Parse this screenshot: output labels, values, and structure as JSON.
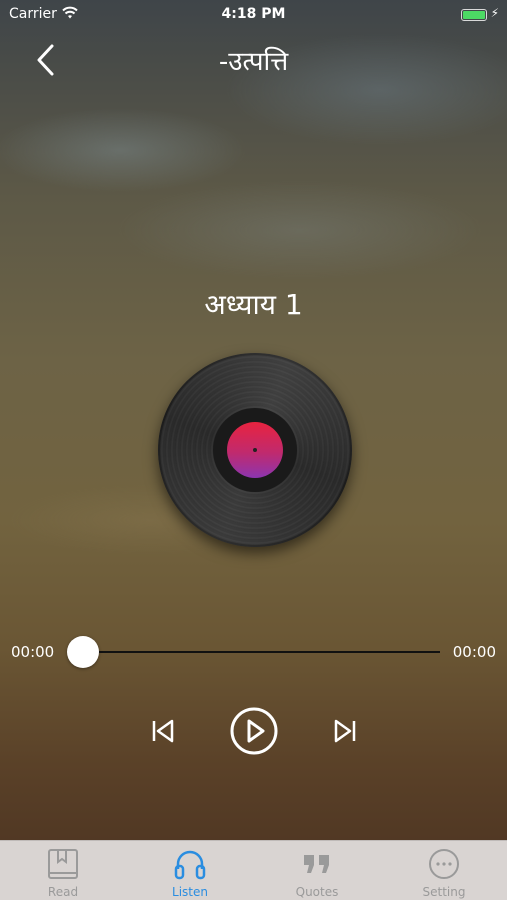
{
  "status_bar": {
    "carrier": "Carrier",
    "time": "4:18 PM"
  },
  "nav": {
    "title": "-उत्पत्ति",
    "back_icon": "chevron-left-icon"
  },
  "player": {
    "chapter": "अध्याय 1",
    "elapsed": "00:00",
    "duration": "00:00",
    "progress": 0
  },
  "tabs": [
    {
      "label": "Read",
      "icon": "book-icon",
      "active": false
    },
    {
      "label": "Listen",
      "icon": "headphones-icon",
      "active": true
    },
    {
      "label": "Quotes",
      "icon": "quote-icon",
      "active": false
    },
    {
      "label": "Setting",
      "icon": "more-icon",
      "active": false
    }
  ],
  "colors": {
    "active_tab": "#2a8de0",
    "inactive_tab": "#9a9a9a",
    "battery": "#4cd964"
  }
}
